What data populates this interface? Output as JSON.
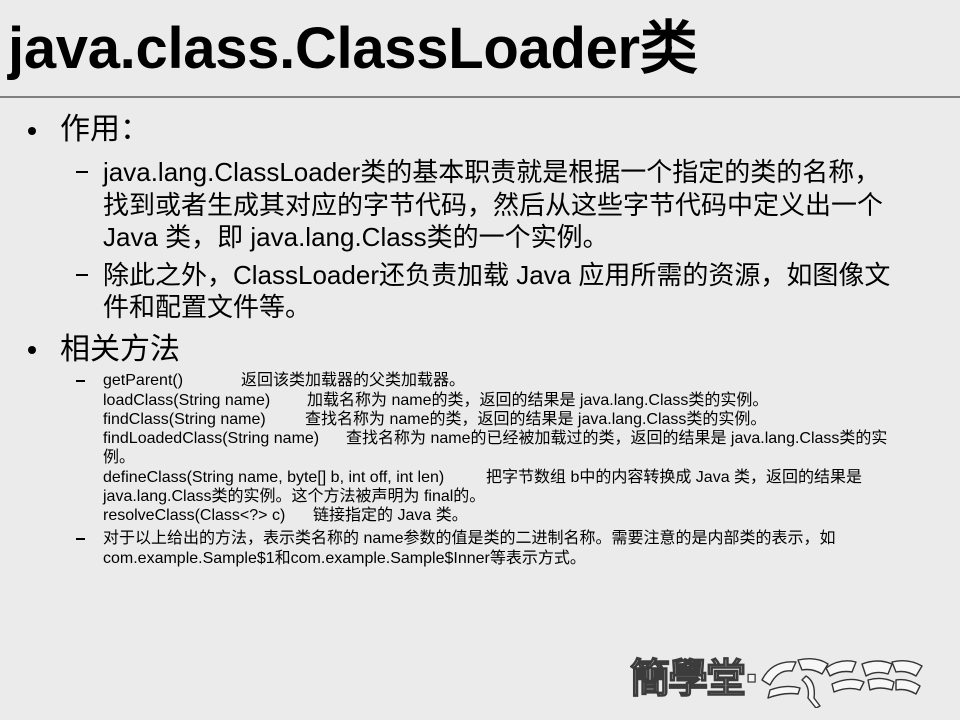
{
  "slide": {
    "title": "java.class.ClassLoader类",
    "sections": [
      {
        "label": "作用：",
        "items": [
          {
            "lines": [
              "java.lang.ClassLoader类的基本职责就是根据一个指定的类的名称，",
              "找到或者生成其对应的字节代码，然后从这些字节代码中定义出一个",
              "Java 类，即 java.lang.Class类的一个实例。"
            ]
          },
          {
            "lines": [
              "除此之外，ClassLoader还负责加载 Java 应用所需的资源，如图像文",
              "件和配置文件等。"
            ]
          }
        ]
      },
      {
        "label": "相关方法",
        "methods": [
          {
            "method": "getParent()",
            "desc": [
              "返回该类加载器的父类加载器。"
            ]
          },
          {
            "method": "loadClass(String name)",
            "desc": [
              "加载名称为 name的类，返回的结果是 java.lang.Class类的实例。"
            ]
          },
          {
            "method": "findClass(String name)",
            "desc": [
              "查找名称为 name的类，返回的结果是 java.lang.Class类的实例。"
            ]
          },
          {
            "method": "findLoadedClass(String name)",
            "desc": [
              "查找名称为 name的已经被加载过的类，返回的结果是 java.lang.Class类的实",
              "例。"
            ]
          },
          {
            "method": "defineClass(String name, byte[] b, int off, int len)",
            "desc": [
              "把字节数组 b中的内容转换成 Java 类，返回的结果是",
              "java.lang.Class类的实例。这个方法被声明为 final的。"
            ]
          },
          {
            "method": "resolveClass(Class<?> c)",
            "desc": [
              "链接指定的 Java 类。"
            ]
          }
        ],
        "note": [
          "对于以上给出的方法，表示类名称的 name参数的值是类的二进制名称。需要注意的是内部类的表示，如",
          "com.example.Sample$1和com.example.Sample$Inner等表示方式。"
        ]
      }
    ]
  },
  "watermark": {
    "text": "簡學堂·"
  },
  "colors": {
    "background": "#ebebeb",
    "text": "#000000",
    "rule": "#7f7f7f"
  }
}
